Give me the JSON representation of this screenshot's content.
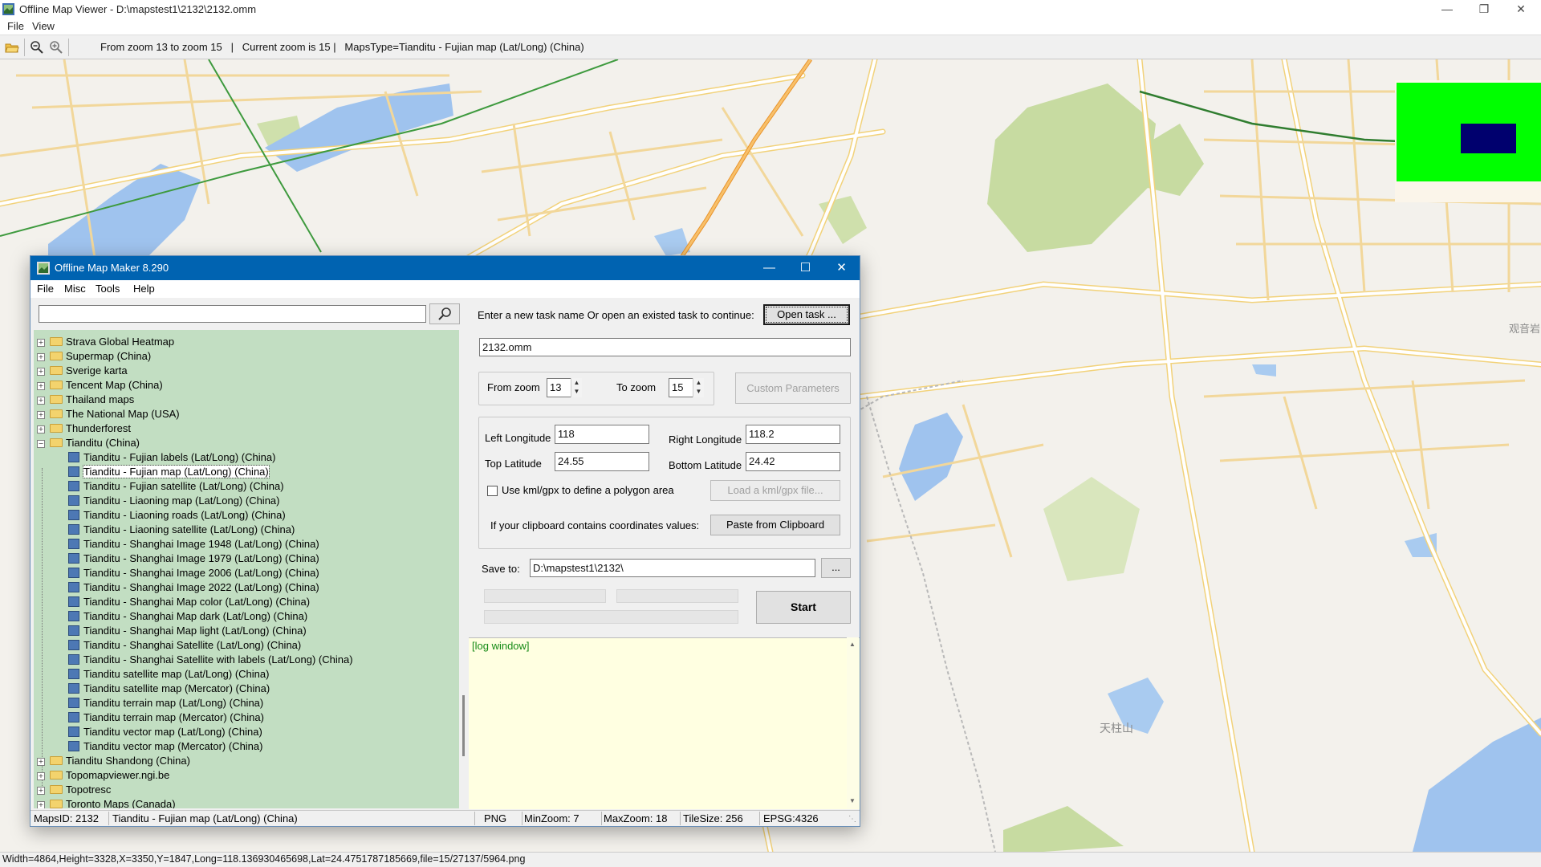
{
  "viewer": {
    "title": "Offline Map Viewer - D:\\mapstest1\\2132\\2132.omm",
    "menu": [
      "File",
      "View"
    ],
    "toolbar_status": "From zoom 13 to zoom 15   |   Current zoom is 15 |   MapsType=Tianditu - Fujian map (Lat/Long) (China)",
    "status": "Width=4864,Height=3328,X=3350,Y=1847,Long=118.136930465698,Lat=24.4751787185669,file=15/27137/5964.png",
    "icons": [
      "open-folder-icon",
      "zoom-out-icon",
      "zoom-in-icon",
      "minimize-icon",
      "restore-icon",
      "close-icon"
    ]
  },
  "map": {
    "labels": [
      "天柱山",
      "观音岩"
    ],
    "colors": {
      "background": "#f3f1ec",
      "road": "#ffffff",
      "road_casing": "#f2d27a",
      "park": "#c7dba1",
      "water": "#9fc3ee",
      "highway": "#f5a53c",
      "rail": "#3e9a3e"
    }
  },
  "overview": {
    "colors": {
      "area": "#00ff00",
      "view": "#00006e"
    }
  },
  "dialog": {
    "title": "Offline Map Maker 8.290",
    "menu": [
      "File",
      "Misc",
      "Tools",
      "Help"
    ],
    "search": {
      "value": "",
      "placeholder": ""
    },
    "tree": [
      {
        "label": "Strava Global Heatmap",
        "type": "folder",
        "expanded": false
      },
      {
        "label": "Supermap (China)",
        "type": "folder",
        "expanded": false
      },
      {
        "label": "Sverige karta",
        "type": "folder",
        "expanded": false
      },
      {
        "label": "Tencent Map (China)",
        "type": "folder",
        "expanded": false
      },
      {
        "label": "Thailand maps",
        "type": "folder",
        "expanded": false
      },
      {
        "label": "The National Map (USA)",
        "type": "folder",
        "expanded": false
      },
      {
        "label": "Thunderforest",
        "type": "folder",
        "expanded": false
      },
      {
        "label": "Tianditu (China)",
        "type": "folder",
        "expanded": true
      },
      {
        "label": "Tianditu - Fujian labels (Lat/Long) (China)",
        "type": "map"
      },
      {
        "label": "Tianditu - Fujian map (Lat/Long) (China)",
        "type": "map",
        "selected": true
      },
      {
        "label": "Tianditu - Fujian satellite (Lat/Long) (China)",
        "type": "map"
      },
      {
        "label": "Tianditu - Liaoning map (Lat/Long) (China)",
        "type": "map"
      },
      {
        "label": "Tianditu - Liaoning roads (Lat/Long) (China)",
        "type": "map"
      },
      {
        "label": "Tianditu - Liaoning satellite (Lat/Long) (China)",
        "type": "map"
      },
      {
        "label": "Tianditu - Shanghai Image 1948 (Lat/Long) (China)",
        "type": "map"
      },
      {
        "label": "Tianditu - Shanghai Image 1979 (Lat/Long) (China)",
        "type": "map"
      },
      {
        "label": "Tianditu - Shanghai Image 2006 (Lat/Long) (China)",
        "type": "map"
      },
      {
        "label": "Tianditu - Shanghai Image 2022 (Lat/Long) (China)",
        "type": "map"
      },
      {
        "label": "Tianditu - Shanghai Map color (Lat/Long) (China)",
        "type": "map"
      },
      {
        "label": "Tianditu - Shanghai Map dark (Lat/Long) (China)",
        "type": "map"
      },
      {
        "label": "Tianditu - Shanghai Map light (Lat/Long) (China)",
        "type": "map"
      },
      {
        "label": "Tianditu - Shanghai Satellite (Lat/Long) (China)",
        "type": "map"
      },
      {
        "label": "Tianditu - Shanghai Satellite with labels (Lat/Long) (China)",
        "type": "map"
      },
      {
        "label": "Tianditu satellite map (Lat/Long) (China)",
        "type": "map"
      },
      {
        "label": "Tianditu satellite map (Mercator) (China)",
        "type": "map"
      },
      {
        "label": "Tianditu terrain map (Lat/Long) (China)",
        "type": "map"
      },
      {
        "label": "Tianditu terrain map (Mercator) (China)",
        "type": "map"
      },
      {
        "label": "Tianditu vector map (Lat/Long) (China)",
        "type": "map"
      },
      {
        "label": "Tianditu vector map (Mercator) (China)",
        "type": "map"
      },
      {
        "label": "Tianditu Shandong (China)",
        "type": "folder",
        "expanded": false
      },
      {
        "label": "Topomapviewer.ngi.be",
        "type": "folder",
        "expanded": false
      },
      {
        "label": "Topotresc",
        "type": "folder",
        "expanded": false
      },
      {
        "label": "Toronto Maps (Canada)",
        "type": "folder",
        "expanded": false
      }
    ],
    "task_prompt": "Enter a new task name Or open an existed task to continue:",
    "open_task_label": "Open task ...",
    "task_name": "2132.omm",
    "from_zoom_label": "From zoom",
    "from_zoom": "13",
    "to_zoom_label": "To zoom",
    "to_zoom": "15",
    "custom_params_label": "Custom Parameters",
    "left_lon_label": "Left Longitude",
    "left_lon": "118",
    "right_lon_label": "Right Longitude",
    "right_lon": "118.2",
    "top_lat_label": "Top Latitude",
    "top_lat": "24.55",
    "bottom_lat_label": "Bottom Latitude",
    "bottom_lat": "24.42",
    "kml_label": "Use kml/gpx to define a polygon area",
    "kml_checked": false,
    "load_kml_label": "Load a kml/gpx file...",
    "clipboard_prompt": "If your clipboard contains coordinates values:",
    "paste_label": "Paste from Clipboard",
    "save_to_label": "Save to:",
    "save_to": "D:\\mapstest1\\2132\\",
    "browse_label": "...",
    "start_label": "Start",
    "progress": [
      0,
      0,
      0
    ],
    "log": "[log window]",
    "status": {
      "maps_id": "MapsID: 2132",
      "maps_name": "Tianditu - Fujian map (Lat/Long) (China)",
      "format": "PNG",
      "min_zoom": "MinZoom: 7",
      "max_zoom": "MaxZoom: 18",
      "tile_size": "TileSize: 256",
      "epsg": "EPSG:4326"
    }
  }
}
